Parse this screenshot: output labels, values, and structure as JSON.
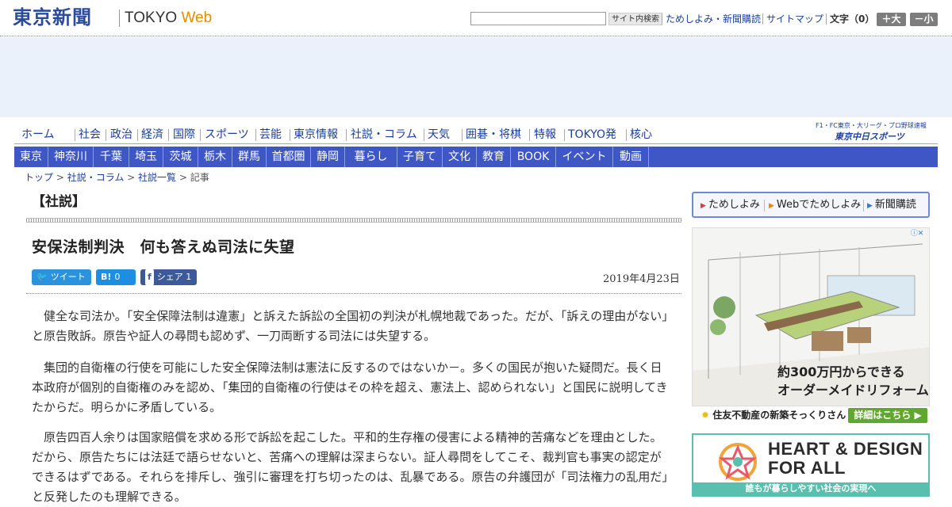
{
  "header": {
    "logo_main": "東京新聞",
    "logo_sub_a": "TOKYO ",
    "logo_sub_b": "Web",
    "search_button": "サイト内検索",
    "links": [
      "ためしよみ・新聞購読",
      "サイトマップ"
    ],
    "font_size_label": "文字（0）",
    "font_bigger": "＋大",
    "font_smaller": "－小"
  },
  "main_nav": [
    "ホーム",
    "社会",
    "政治",
    "経済",
    "国際",
    "スポーツ",
    "芸能",
    "東京情報",
    "社説・コラム",
    "天気",
    "囲碁・将棋",
    "特報",
    "TOKYO発",
    "核心"
  ],
  "chunichi": {
    "top": "F1・FC東京・大リーグ・プロ野球速報",
    "logo": "東京中日スポーツ"
  },
  "region_nav": [
    "東京",
    "神奈川",
    "千葉",
    "埼玉",
    "茨城",
    "栃木",
    "群馬",
    "首都圏",
    "静岡",
    "暮らし",
    "子育て",
    "文化",
    "教育",
    "BOOK",
    "イベント",
    "動画"
  ],
  "breadcrumb": {
    "items": [
      "トップ",
      "社説・コラム",
      "社説一覧"
    ],
    "separator": " > ",
    "current": "記事"
  },
  "section_title": "【社説】",
  "article": {
    "title": "安保法制判決　何も答えぬ司法に失望",
    "date": "2019年4月23日",
    "share": {
      "tweet": "ツイート",
      "hatena_count": "0",
      "facebook": "シェア",
      "facebook_count": "1"
    },
    "paragraphs": [
      "健全な司法か。「安全保障法制は違憲」と訴えた訴訟の全国初の判決が札幌地裁であった。だが、「訴えの理由がない」と原告敗訴。原告や証人の尋問も認めず、一刀両断する司法には失望する。",
      "集団的自衛権の行使を可能にした安全保障法制は憲法に反するのではないか－。多くの国民が抱いた疑問だ。長く日本政府が個別的自衛権のみを認め、「集団的自衛権の行使はその枠を超え、憲法上、認められない」と国民に説明してきたからだ。明らかに矛盾している。",
      "原告四百人余りは国家賠償を求める形で訴訟を起こした。平和的生存権の侵害による精神的苦痛などを理由とした。だから、原告たちには法廷で語らせないと、苦痛への理解は深まらない。証人尋問をしてこそ、裁判官も事実の認定ができるはずである。それらを排斥し、強引に審理を打ち切ったのは、乱暴である。原告の弁護団が「司法権力の乱用だ」と反発したのも理解できる。"
    ]
  },
  "sidebar": {
    "tabs": [
      "ためしよみ",
      "Webでためしよみ",
      "新聞購読"
    ],
    "ad1": {
      "copy_line1": "約300万円からできる",
      "copy_line2": "オーダーメイドリフォーム",
      "brand": "住友不動産の新築そっくりさん",
      "cta": "詳細はこちら"
    },
    "ad2": {
      "line1": "HEART & DESIGN",
      "line2": "FOR ALL",
      "strip": "誰もが暮らしやすい社会の実現へ"
    }
  },
  "colors": {
    "brand_blue": "#2b4b9b",
    "region_nav_bg": "#3f57c4",
    "link": "#1a3e9e",
    "tweet": "#2b93dd",
    "facebook": "#3c5a9a",
    "ad2_accent": "#5bbfb0"
  }
}
